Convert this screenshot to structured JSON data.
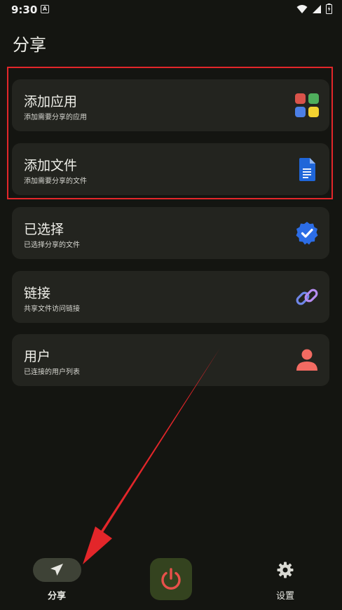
{
  "status": {
    "time": "9:30"
  },
  "page": {
    "title": "分享"
  },
  "cards": [
    {
      "title": "添加应用",
      "subtitle": "添加需要分享的应用",
      "icon": "apps-grid-icon"
    },
    {
      "title": "添加文件",
      "subtitle": "添加需要分享的文件",
      "icon": "document-icon"
    },
    {
      "title": "已选择",
      "subtitle": "已选择分享的文件",
      "icon": "verified-badge-icon"
    },
    {
      "title": "链接",
      "subtitle": "共享文件访问链接",
      "icon": "link-icon"
    },
    {
      "title": "用户",
      "subtitle": "已连接的用户列表",
      "icon": "user-icon"
    }
  ],
  "bottom_nav": {
    "share_label": "分享",
    "settings_label": "设置",
    "active": "share"
  },
  "colors": {
    "background": "#141511",
    "card": "#23241f",
    "highlight": "#e3262a",
    "power_bg": "#34431f",
    "power_icon": "#e8504a",
    "pill": "#3e4236"
  }
}
